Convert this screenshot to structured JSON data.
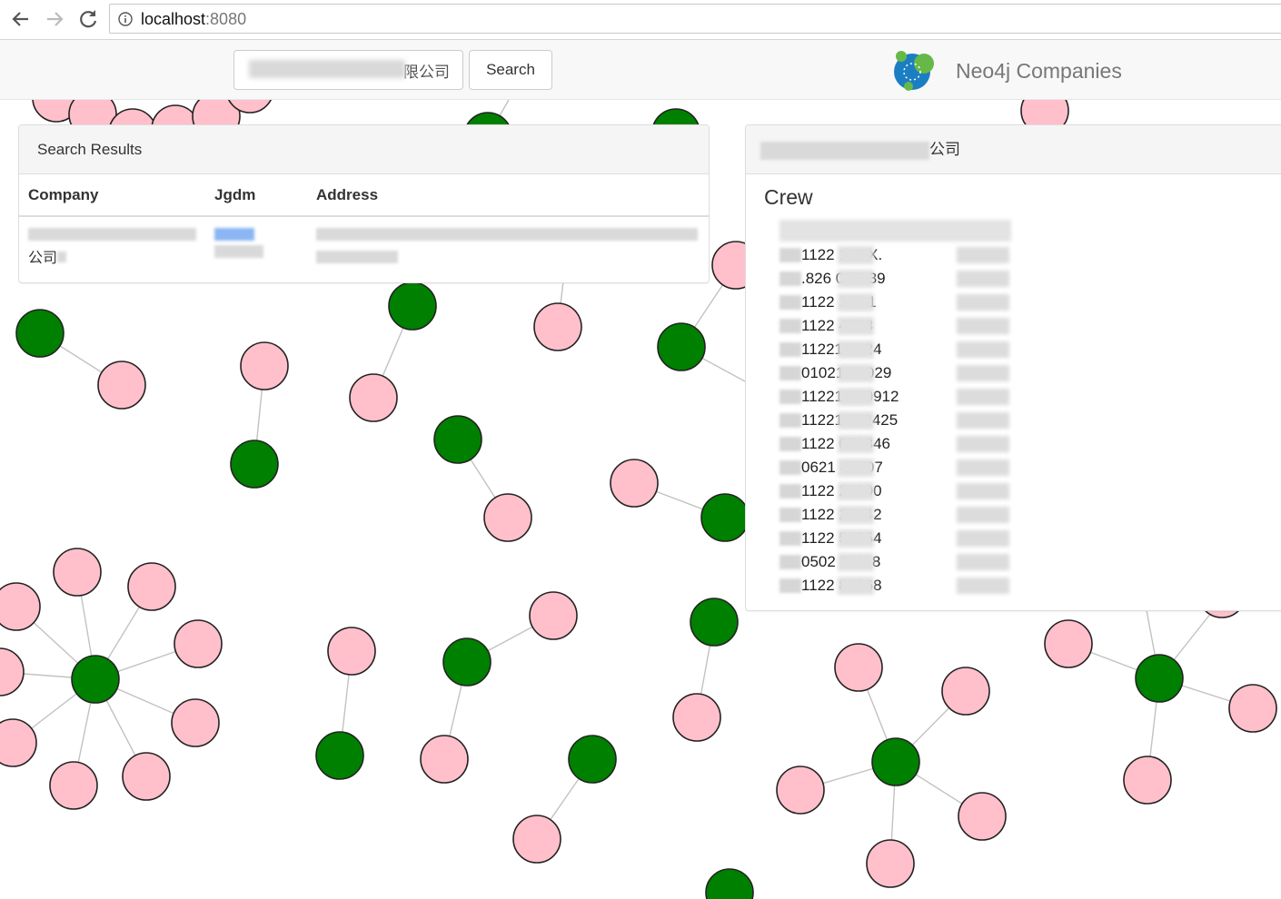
{
  "browser": {
    "url_host": "localhost",
    "url_port": ":8080"
  },
  "navbar": {
    "search_value": "限公司",
    "search_button": "Search",
    "brand": "Neo4j Companies"
  },
  "results": {
    "title": "Search Results",
    "columns": [
      "Company",
      "Jgdm",
      "Address"
    ],
    "rows": [
      {
        "company": "公司"
      }
    ]
  },
  "detail": {
    "title": "公司",
    "section": "Crew",
    "crew": [
      "1122  113  X.",
      ".826  01C  39",
      "1122  112  1",
      "1122  4068",
      "11221  4024",
      "01021  31029",
      "11221  120912",
      "11221  112425",
      "1122  051346",
      "0621  42707",
      "1122  21900",
      "1122  22142",
      "1122  51054",
      "0502  51118",
      "1122  81668"
    ]
  },
  "graph": {
    "company_color": "#008000",
    "person_color": "#ffc0cb"
  }
}
